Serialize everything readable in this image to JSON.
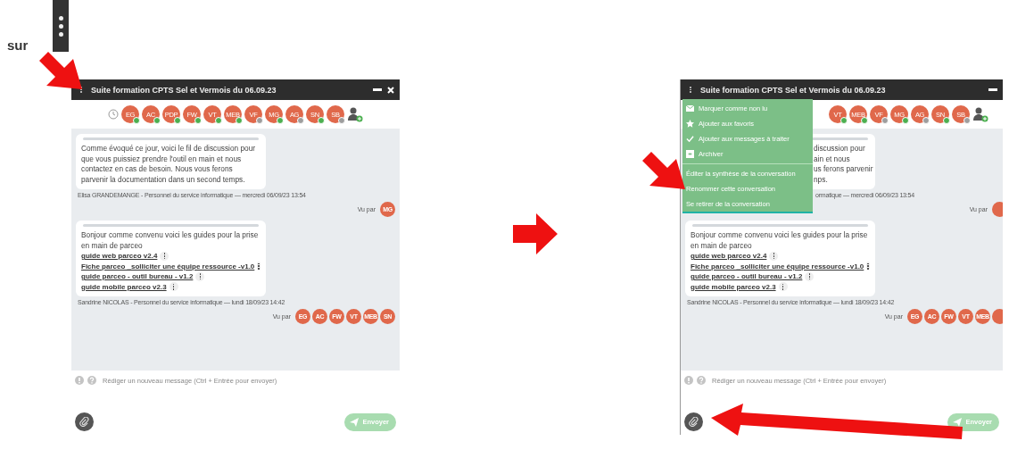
{
  "instruction": {
    "text": "sur"
  },
  "windows": [
    {
      "title": "Suite formation CPTS Sel et Vermois du 06.09.23",
      "close_icon": true,
      "history_icon": true,
      "participants": [
        {
          "initials": "EG",
          "online": true
        },
        {
          "initials": "AC",
          "online": true
        },
        {
          "initials": "PDP",
          "online": true
        },
        {
          "initials": "FW",
          "online": true
        },
        {
          "initials": "VT",
          "online": true
        },
        {
          "initials": "MEB",
          "online": true
        },
        {
          "initials": "VF",
          "online": false
        },
        {
          "initials": "MG",
          "online": true
        },
        {
          "initials": "AG",
          "online": false
        },
        {
          "initials": "SN",
          "online": true
        },
        {
          "initials": "SB",
          "online": false
        }
      ],
      "messages": [
        {
          "kind": "text",
          "lines": [
            "Comme évoqué ce jour, voici le fil de discussion pour que vous puissiez prendre l'outil en main et nous contactez en cas de besoin. Nous vous ferons parvenir la documentation dans un second temps."
          ],
          "meta": "Elisa GRANDEMANGE - Personnel du service informatique  —  mercredi 06/09/23 13:54",
          "seen_label": "Vu par",
          "seen_by": [
            "MG"
          ]
        },
        {
          "kind": "links",
          "lines": [
            "Bonjour comme convenu voici les guides pour la prise en main de parceo"
          ],
          "links": [
            "guide web parceo v2.4",
            "Fiche parceo _solliciter une équipe ressource -v1.0",
            "guide parceo - outil bureau - v1.2",
            "guide mobile parceo v2.3"
          ],
          "meta": "Sandrine NICOLAS - Personnel du service informatique  —  lundi 18/09/23 14:42",
          "seen_label": "Vu par",
          "seen_by": [
            "EG",
            "AC",
            "FW",
            "VT",
            "MEB",
            "SN"
          ]
        }
      ],
      "composer": {
        "placeholder": "Rédiger un nouveau message (Ctrl + Entrée pour envoyer)",
        "send_label": "Envoyer"
      }
    },
    {
      "title": "Suite formation CPTS Sel et Vermois du 06.09.23",
      "close_icon": false,
      "history_icon": false,
      "participants": [
        {
          "initials": "VT",
          "online": true
        },
        {
          "initials": "MEB",
          "online": true
        },
        {
          "initials": "VF",
          "online": false
        },
        {
          "initials": "MG",
          "online": true
        },
        {
          "initials": "AG",
          "online": false
        },
        {
          "initials": "SN",
          "online": true
        },
        {
          "initials": "SB",
          "online": false
        }
      ],
      "messages": [
        {
          "kind": "covered",
          "lines": [
            "discussion pour",
            "ain et nous",
            "us ferons parvenir",
            "nps."
          ],
          "meta": "ormatique  —  mercredi 06/09/23 13:54",
          "seen_label": "Vu par",
          "seen_cut": true
        },
        {
          "kind": "links",
          "lines": [
            "Bonjour comme convenu voici les guides pour la prise en main de parceo"
          ],
          "links": [
            "guide web parceo v2.4",
            "Fiche parceo _solliciter une équipe ressource -v1.0",
            "guide parceo - outil bureau - v1.2",
            "guide mobile parceo v2.3"
          ],
          "meta": "Sandrine NICOLAS - Personnel du service informatique  —  lundi 18/09/23 14:42",
          "seen_label": "Vu par",
          "seen_by": [
            "EG",
            "AC",
            "FW",
            "VT",
            "MEB"
          ],
          "seen_cut": true
        }
      ],
      "composer": {
        "placeholder": "Rédiger un nouveau message (Ctrl + Entrée pour envoyer)",
        "send_label": "Envoyer"
      },
      "menu": {
        "groups": [
          [
            "Marquer comme non lu",
            "Ajouter aux favoris",
            "Ajouter aux messages à traiter",
            "Archiver"
          ],
          [
            "Éditer la synthèse de la conversation",
            "Renommer cette conversation",
            "Se retirer de la conversation"
          ]
        ]
      }
    }
  ]
}
